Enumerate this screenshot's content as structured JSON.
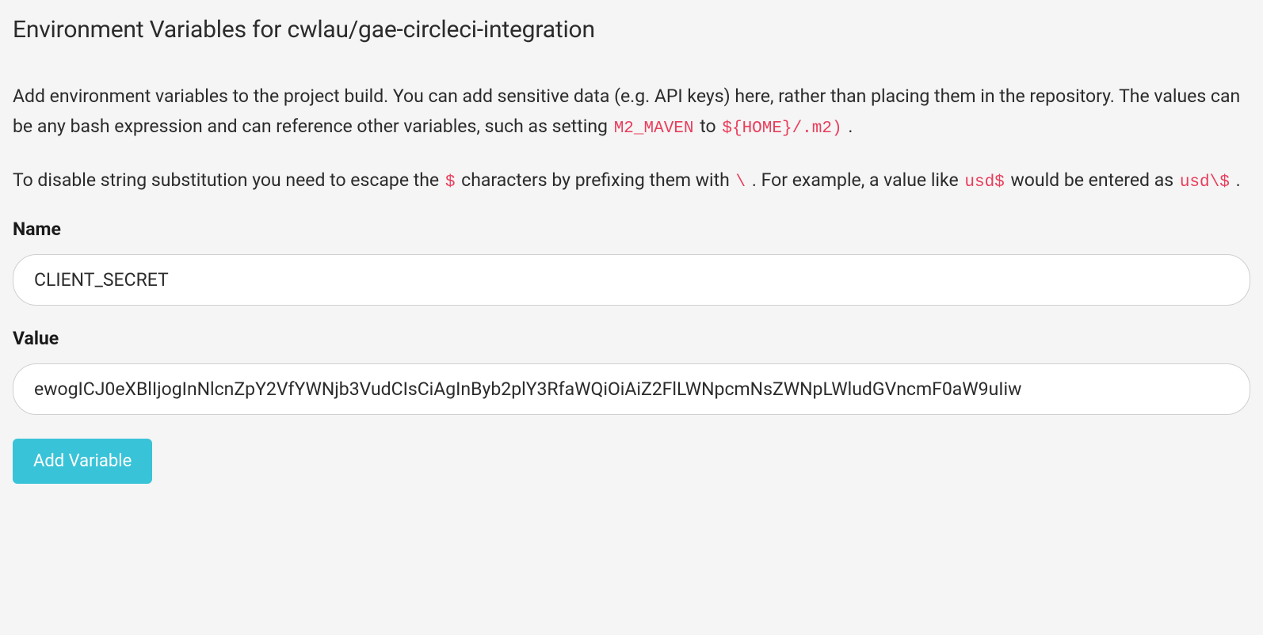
{
  "header": {
    "title": "Environment Variables for cwlau/gae-circleci-integration"
  },
  "description": {
    "para1_part1": "Add environment variables to the project build. You can add sensitive data (e.g. API keys) here, rather than placing them in the repository. The values can be any bash expression and can reference other variables, such as setting ",
    "para1_code1": "M2_MAVEN",
    "para1_part2": " to ",
    "para1_code2": "${HOME}/.m2)",
    "para1_part3": " .",
    "para2_part1": "To disable string substitution you need to escape the ",
    "para2_code1": "$",
    "para2_part2": " characters by prefixing them with ",
    "para2_code2": "\\",
    "para2_part3": " . For example, a value like ",
    "para2_code3": "usd$",
    "para2_part4": " would be entered as ",
    "para2_code4": "usd\\$",
    "para2_part5": " ."
  },
  "form": {
    "name_label": "Name",
    "name_value": "CLIENT_SECRET",
    "value_label": "Value",
    "value_value": "ewogICJ0eXBlIjogInNlcnZpY2VfYWNjb3VudCIsCiAgInByb2plY3RfaWQiOiAiZ2FlLWNpcmNsZWNpLWludGVncmF0aW9uIiw",
    "submit_label": "Add Variable"
  }
}
